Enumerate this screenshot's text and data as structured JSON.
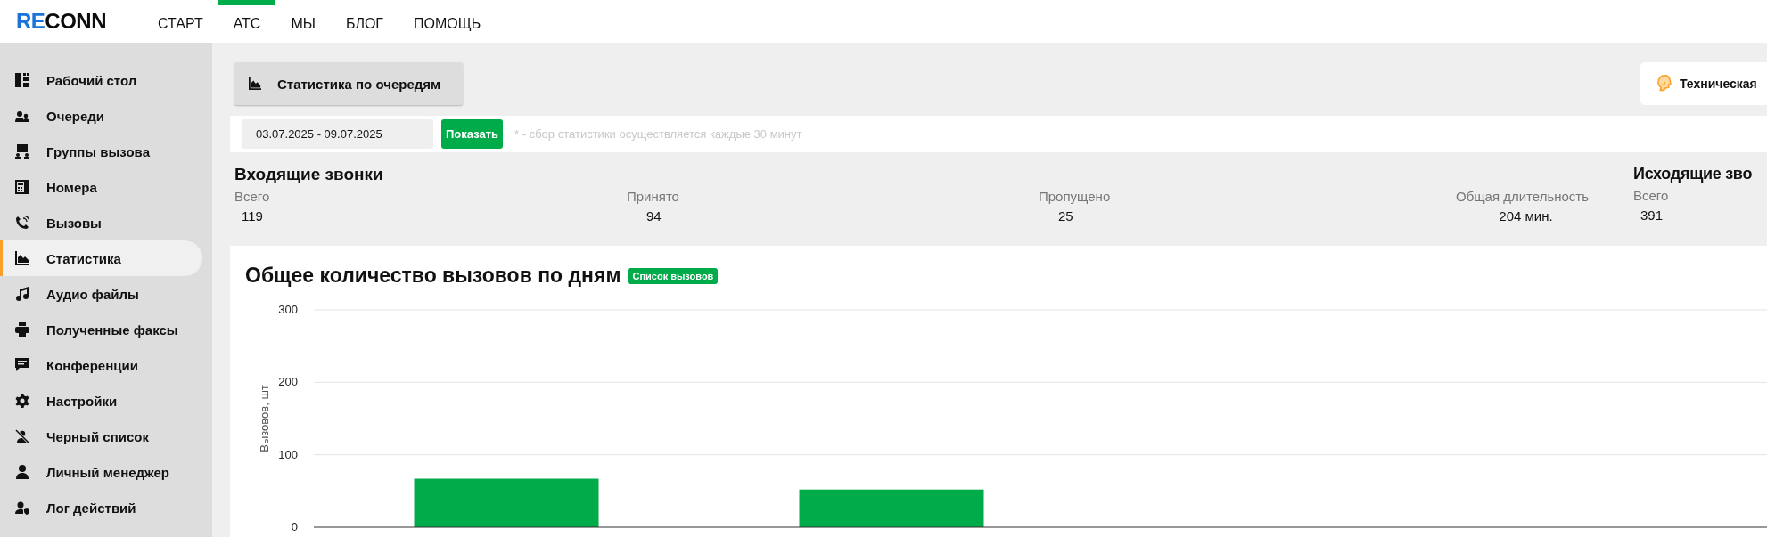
{
  "header": {
    "logo": [
      {
        "text": "RE",
        "kind": "accent"
      },
      {
        "text": "CONN",
        "kind": "plain"
      }
    ],
    "nav": [
      {
        "label": "СТАРТ",
        "selected": false
      },
      {
        "label": "АТС",
        "selected": true
      },
      {
        "label": "МЫ",
        "selected": false
      },
      {
        "label": "БЛОГ",
        "selected": false
      },
      {
        "label": "ПОМОЩЬ",
        "selected": false
      }
    ]
  },
  "sidebar": {
    "items": [
      {
        "label": "Рабочий стол",
        "selected": false
      },
      {
        "label": "Очереди",
        "selected": false
      },
      {
        "label": "Группы вызова",
        "selected": false
      },
      {
        "label": "Номера",
        "selected": false
      },
      {
        "label": "Вызовы",
        "selected": false
      },
      {
        "label": "Статистика",
        "selected": true
      },
      {
        "label": "Аудио файлы",
        "selected": false
      },
      {
        "label": "Полученные факсы",
        "selected": false
      },
      {
        "label": "Конференции",
        "selected": false
      },
      {
        "label": "Настройки",
        "selected": false
      },
      {
        "label": "Черный список",
        "selected": false
      },
      {
        "label": "Личный менеджер",
        "selected": false
      },
      {
        "label": "Лог действий",
        "selected": false
      }
    ]
  },
  "queue_stats_button": {
    "label": "Статистика по очередям"
  },
  "support_card": {
    "label": "Техническая"
  },
  "filter": {
    "date_range": "03.07.2025 - 09.07.2025",
    "show_button": "Показать",
    "note": "* - сбор статистики осуществляется каждые 30 минут"
  },
  "incoming": {
    "title": "Входящие звонки",
    "stats": [
      {
        "label": "Всего",
        "value": "119"
      },
      {
        "label": "Принято",
        "value": "94"
      },
      {
        "label": "Пропущено",
        "value": "25"
      },
      {
        "label": "Общая длительность",
        "value": "204 мин."
      }
    ]
  },
  "outgoing": {
    "title": "Исходящие зво",
    "stats": [
      {
        "label": "Всего",
        "value": "391"
      }
    ]
  },
  "daily_chart": {
    "title": "Общее количество вызовов по дням",
    "badge": "Список вызовов",
    "chart_data": {
      "type": "bar",
      "ylabel": "Вызовов, шт",
      "ylim": [
        0,
        300
      ],
      "yticks": [
        0,
        100,
        200,
        300
      ],
      "series": [
        {
          "color": "#00ab4a",
          "values": [
            67,
            52
          ]
        }
      ]
    }
  }
}
